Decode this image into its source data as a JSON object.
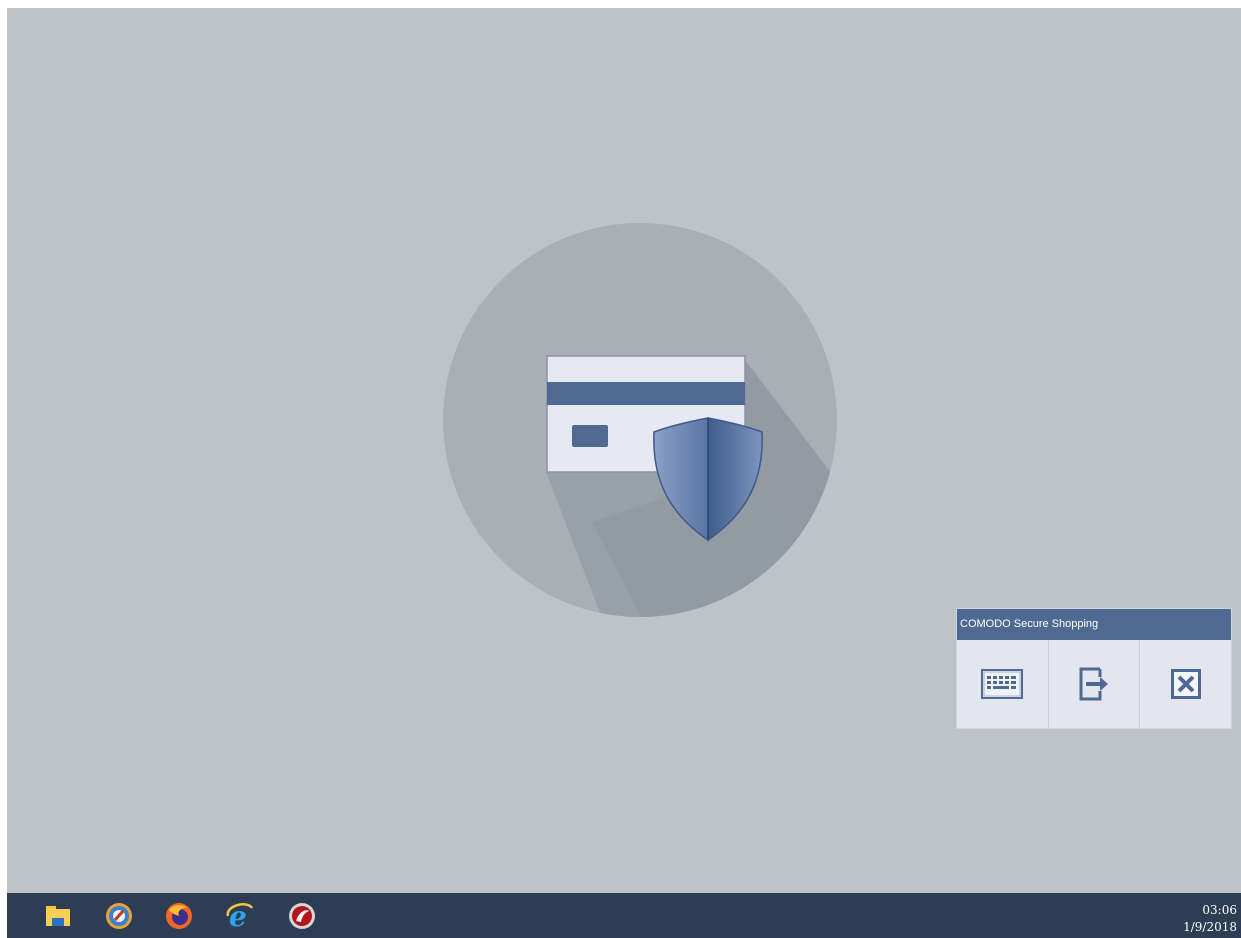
{
  "panel": {
    "title": "COMODO Secure Shopping",
    "buttons": [
      {
        "icon": "keyboard-icon"
      },
      {
        "icon": "switch-desktop-icon"
      },
      {
        "icon": "close-icon"
      }
    ]
  },
  "taskbar": {
    "icons": [
      "file-explorer-icon",
      "comodo-dragon-icon",
      "firefox-icon",
      "internet-explorer-icon",
      "comodo-ice-dragon-icon"
    ],
    "clock": {
      "time": "03:06",
      "date": "1/9/2018"
    }
  },
  "colors": {
    "desktop": "#bec3c7",
    "accent": "#4e6a93",
    "taskbar": "#2d3e54"
  }
}
